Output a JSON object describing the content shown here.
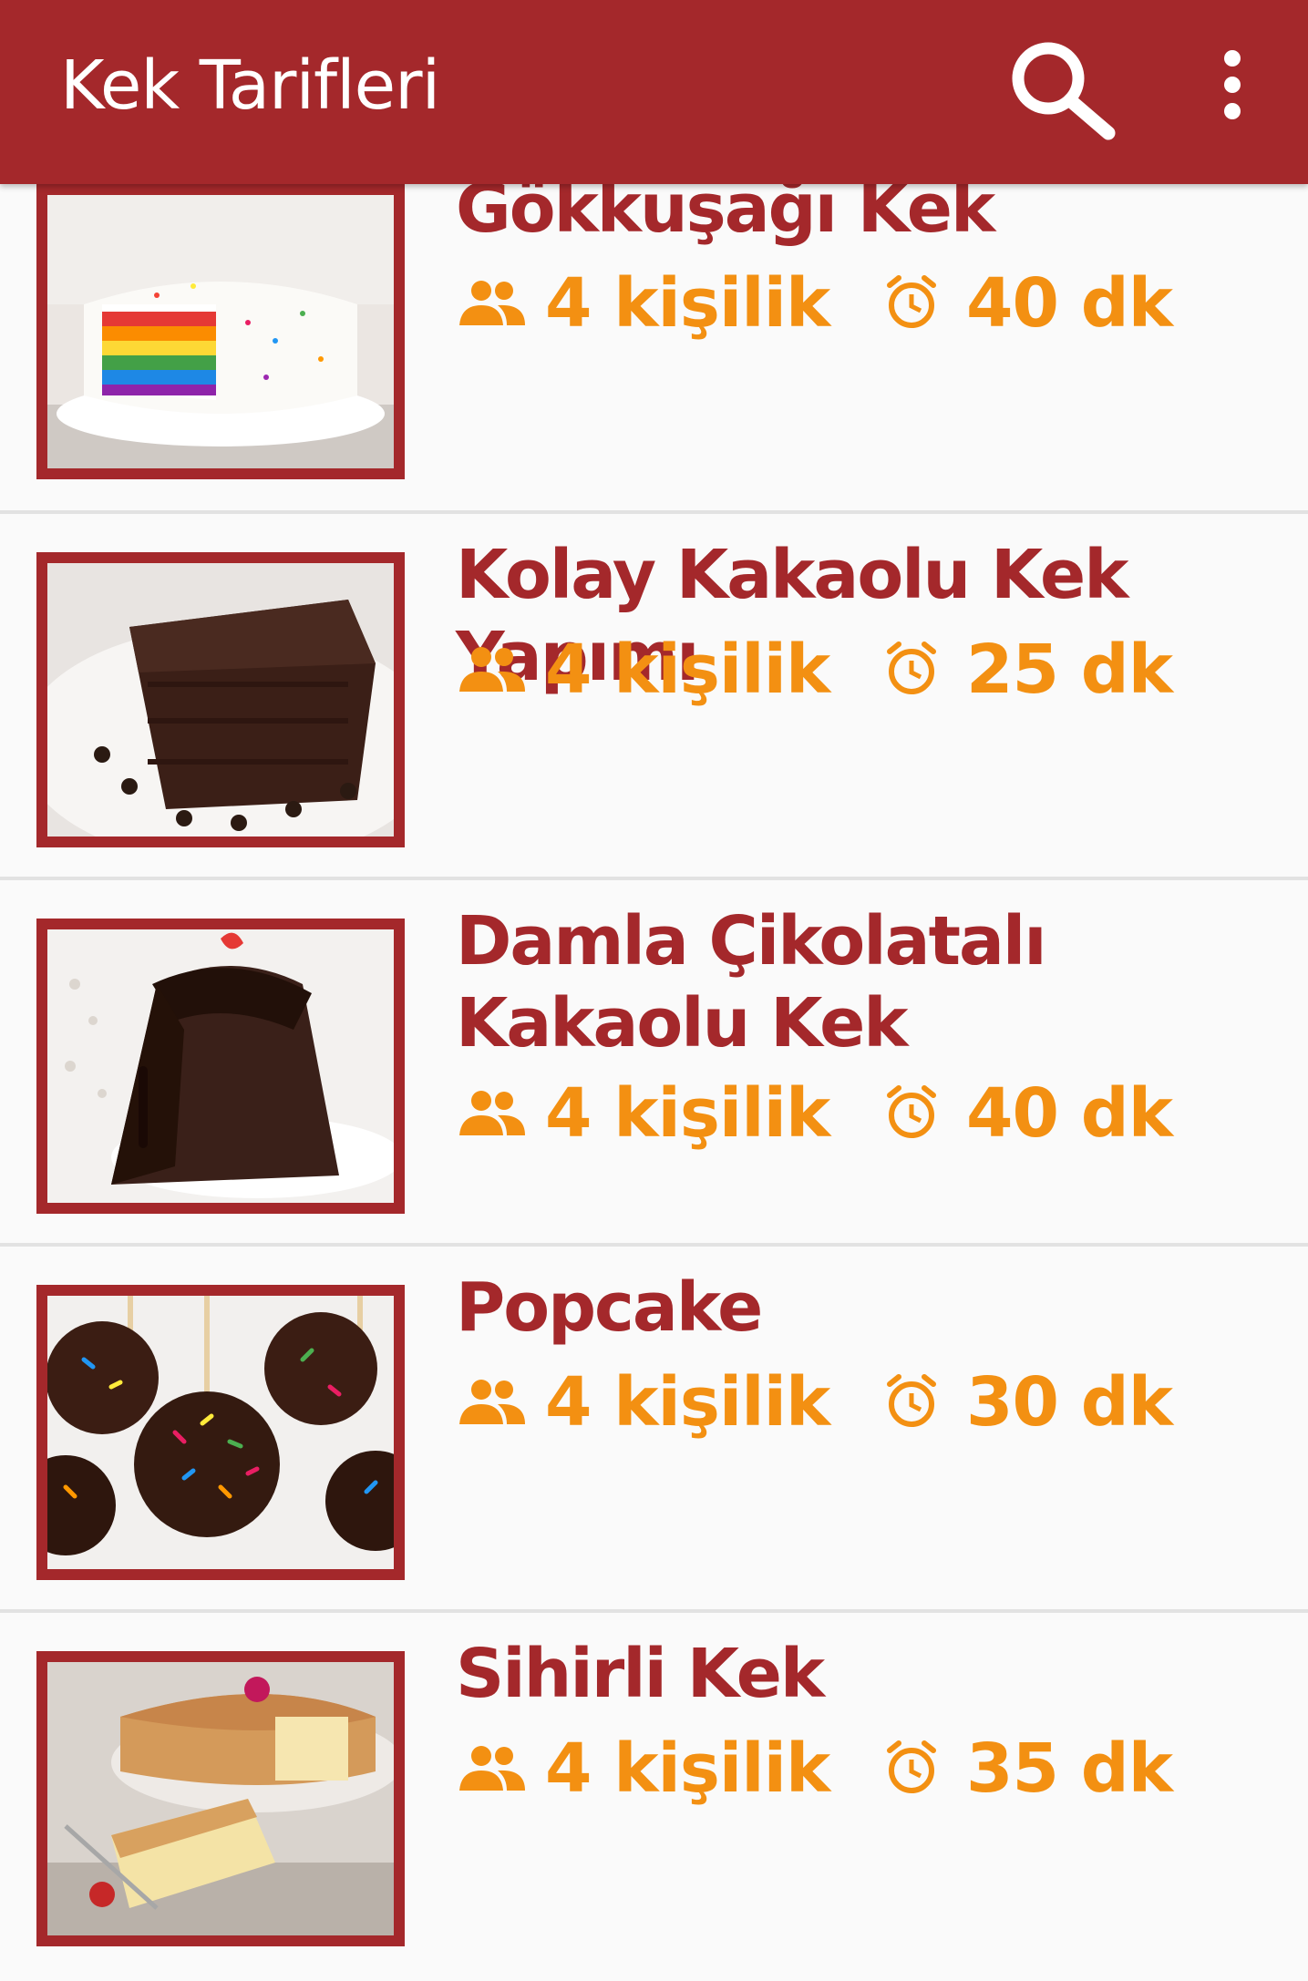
{
  "appbar": {
    "title": "Kek Tarifleri",
    "search_icon": "search-icon",
    "menu_icon": "more-vert-icon",
    "background": "#a4282b"
  },
  "colors": {
    "accent": "#a4282b",
    "meta": "#f39012",
    "divider": "#e2e2e2"
  },
  "recipes": [
    {
      "title": "Gökkuşağı Kek",
      "servings": "4 kişilik",
      "time": "40 dk",
      "image": "rainbow-cake"
    },
    {
      "title": "Kolay Kakaolu Kek Yapımı",
      "servings": "4 kişilik",
      "time": "25 dk",
      "image": "cocoa-cake"
    },
    {
      "title": "Damla Çikolatalı Kakaolu Kek",
      "servings": "4 kişilik",
      "time": "40 dk",
      "image": "chocolate-bundt-cake"
    },
    {
      "title": "Popcake",
      "servings": "4 kişilik",
      "time": "30 dk",
      "image": "cake-pops"
    },
    {
      "title": "Sihirli Kek",
      "servings": "4 kişilik",
      "time": "35 dk",
      "image": "magic-sponge-cake"
    }
  ]
}
